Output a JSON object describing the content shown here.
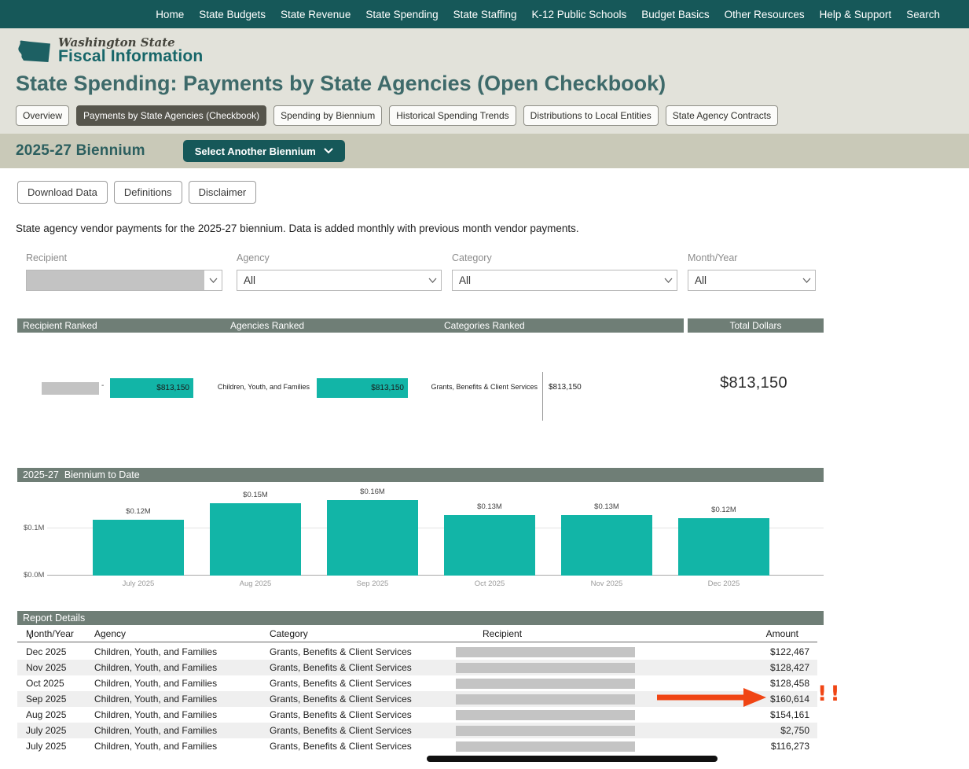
{
  "colors": {
    "nav_bg": "#165859",
    "header_bg": "#e2e2da",
    "biennium_bg": "#c9c9b8",
    "section_bar_bg": "#6f7e76",
    "teal_bar": "#12b5a7",
    "active_tab_bg": "#56554c",
    "redaction_gray": "#c3c3c3",
    "row_stripe": "#efefef",
    "annotation_red": "#f04514"
  },
  "nav": {
    "items": [
      "Home",
      "State Budgets",
      "State Revenue",
      "State Spending",
      "State Staffing",
      "K-12 Public Schools",
      "Budget Basics",
      "Other Resources",
      "Help & Support",
      "Search"
    ]
  },
  "header": {
    "logo_line1": "Washington State",
    "logo_line2": "Fiscal Information",
    "page_title": "State Spending: Payments by State Agencies (Open Checkbook)"
  },
  "tabs": [
    {
      "label": "Overview",
      "active": false
    },
    {
      "label": "Payments by State Agencies (Checkbook)",
      "active": true
    },
    {
      "label": "Spending by Biennium",
      "active": false
    },
    {
      "label": "Historical Spending Trends",
      "active": false
    },
    {
      "label": "Distributions to Local Entities",
      "active": false
    },
    {
      "label": "State Agency Contracts",
      "active": false
    }
  ],
  "biennium": {
    "title": "2025-27 Biennium",
    "button_label": "Select Another Biennium"
  },
  "toolbar": {
    "buttons": [
      "Download Data",
      "Definitions",
      "Disclaimer"
    ]
  },
  "description": "State agency vendor payments for the 2025-27 biennium. Data is added monthly with previous month vendor payments.",
  "filters": [
    {
      "label": "Recipient",
      "value": "",
      "redacted": true
    },
    {
      "label": "Agency",
      "value": "All",
      "redacted": false
    },
    {
      "label": "Category",
      "value": "All",
      "redacted": false
    },
    {
      "label": "Month/Year",
      "value": "All",
      "redacted": false
    }
  ],
  "chart_data": [
    {
      "id": "ranked-totals",
      "type": "bar",
      "orientation": "horizontal",
      "panels": [
        {
          "header": "Recipient Ranked",
          "category": "",
          "category_redacted": true,
          "value": 813150,
          "label": "$813,150"
        },
        {
          "header": "Agencies Ranked",
          "category": "Children, Youth, and Families",
          "value": 813150,
          "label": "$813,150"
        },
        {
          "header": "Categories Ranked",
          "category": "Grants, Benefits & Client Services",
          "value": 813150,
          "label": "$813,150"
        }
      ],
      "total_header": "Total Dollars",
      "total_value": 813150,
      "total_label": "$813,150"
    },
    {
      "id": "biennium-to-date",
      "type": "bar",
      "title": "2025-27  Biennium to Date",
      "categories": [
        "July 2025",
        "Aug 2025",
        "Sep 2025",
        "Oct 2025",
        "Nov 2025",
        "Dec 2025"
      ],
      "values": [
        119023,
        154161,
        160614,
        128458,
        128427,
        122467
      ],
      "value_labels": [
        "$0.12M",
        "$0.15M",
        "$0.16M",
        "$0.13M",
        "$0.13M",
        "$0.12M"
      ],
      "y_ticks": [
        "$0.0M",
        "$0.1M"
      ],
      "y_tick_values": [
        0,
        100000
      ],
      "ylim": [
        0,
        166000
      ],
      "unit": "USD",
      "bar_color": "#12b5a7",
      "grid": true,
      "legend": false
    }
  ],
  "sections": {
    "report_details_title": "Report Details"
  },
  "report_table": {
    "columns": [
      "Month/Year",
      "Agency",
      "Category",
      "Recipient",
      "Amount"
    ],
    "rows": [
      {
        "month_year": "Dec 2025",
        "agency": "Children, Youth, and Families",
        "category": "Grants, Benefits & Client Services",
        "recipient_redacted": true,
        "amount": "$122,467"
      },
      {
        "month_year": "Nov 2025",
        "agency": "Children, Youth, and Families",
        "category": "Grants, Benefits & Client Services",
        "recipient_redacted": true,
        "amount": "$128,427"
      },
      {
        "month_year": "Oct 2025",
        "agency": "Children, Youth, and Families",
        "category": "Grants, Benefits & Client Services",
        "recipient_redacted": true,
        "amount": "$128,458"
      },
      {
        "month_year": "Sep 2025",
        "agency": "Children, Youth, and Families",
        "category": "Grants, Benefits & Client Services",
        "recipient_redacted": true,
        "amount": "$160,614",
        "annotated": true
      },
      {
        "month_year": "Aug 2025",
        "agency": "Children, Youth, and Families",
        "category": "Grants, Benefits & Client Services",
        "recipient_redacted": true,
        "amount": "$154,161"
      },
      {
        "month_year": "July 2025",
        "agency": "Children, Youth, and Families",
        "category": "Grants, Benefits & Client Services",
        "recipient_redacted": true,
        "amount": "$2,750"
      },
      {
        "month_year": "July 2025",
        "agency": "Children, Youth, and Families",
        "category": "Grants, Benefits & Client Services",
        "recipient_redacted": true,
        "amount": "$116,273"
      }
    ]
  },
  "annotations": {
    "exclamation": "!!"
  }
}
